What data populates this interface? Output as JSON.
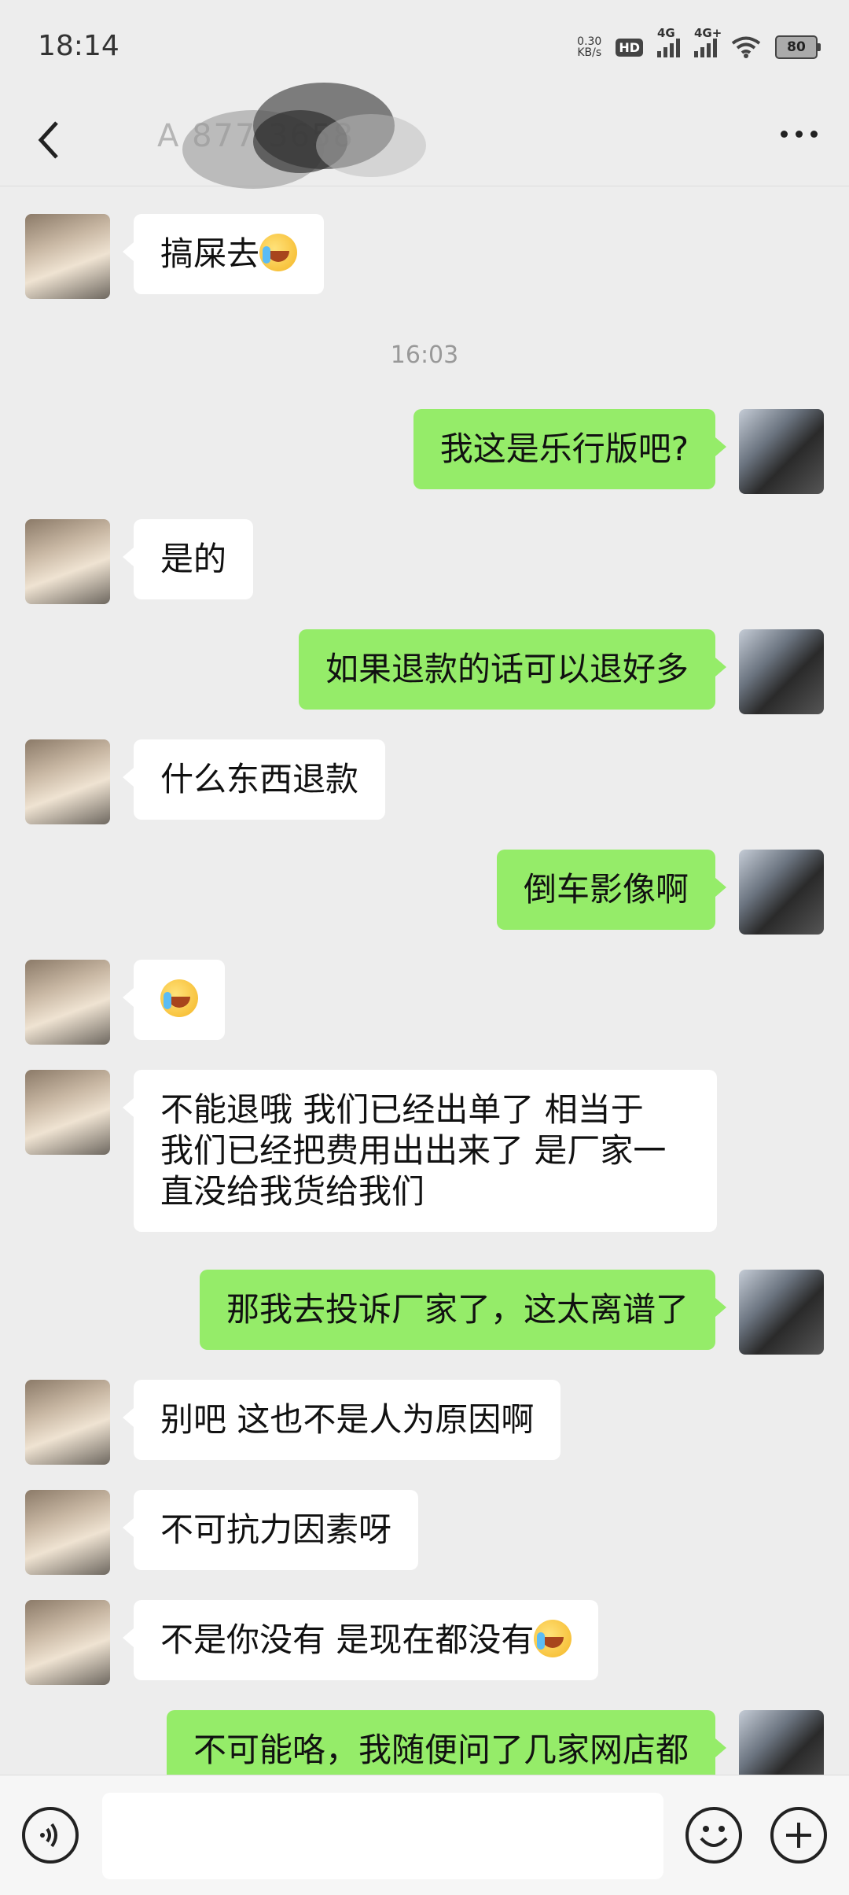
{
  "status_bar": {
    "time": "18:14",
    "net_speed_value": "0.30",
    "net_speed_unit": "KB/s",
    "hd_label": "HD",
    "sim1_label": "4G",
    "sim2_label": "4G+",
    "battery": "80"
  },
  "header": {
    "title": "A          877  3658"
  },
  "messages": [
    {
      "side": "in",
      "text": "搞屎去"
    },
    {
      "side": "time",
      "text": "16:03"
    },
    {
      "side": "out",
      "text": "我这是乐行版吧?"
    },
    {
      "side": "in",
      "text": "是的"
    },
    {
      "side": "out",
      "text": "如果退款的话可以退好多"
    },
    {
      "side": "in",
      "text": "什么东西退款"
    },
    {
      "side": "out",
      "text": "倒车影像啊"
    },
    {
      "side": "in",
      "text": ""
    },
    {
      "side": "in",
      "text": "不能退哦 我们已经出单了 相当于\n我们已经把费用出出来了 是厂家一\n直没给我货给我们"
    },
    {
      "side": "out",
      "text": "那我去投诉厂家了，这太离谱了"
    },
    {
      "side": "in",
      "text": "别吧 这也不是人为原因啊"
    },
    {
      "side": "in",
      "text": "不可抗力因素呀"
    },
    {
      "side": "in",
      "text": "不是你没有 是现在都没有"
    },
    {
      "side": "out",
      "text": "不可能咯，我随便问了几家网店都"
    }
  ],
  "icons": {
    "emoji": "face-with-tears-emoji",
    "contact_avatar": "woman-photo-avatar",
    "self_avatar": "man-with-chains-avatar"
  }
}
